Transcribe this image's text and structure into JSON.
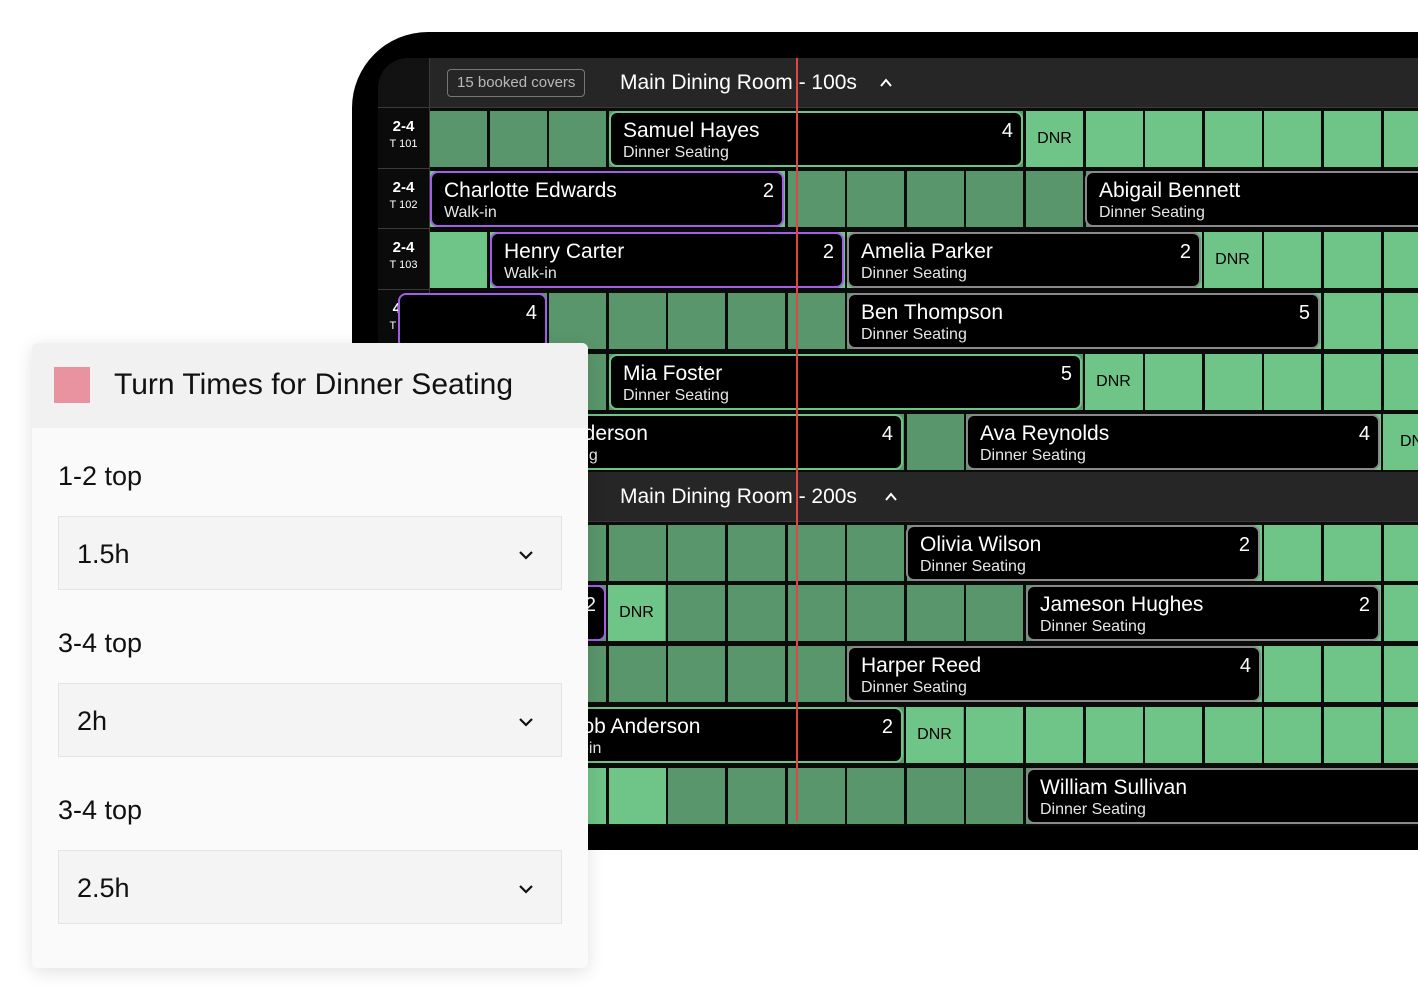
{
  "floor": {
    "booked_covers": "15 booked covers",
    "time_indicator_color": "#e04545",
    "colors": {
      "slot_free": "#6fc487",
      "slot_blocked": "#5a966b",
      "seated_outline": "#6fc487",
      "walkin_outline": "#a45ee6",
      "booked_outline": "#8a8a8a"
    },
    "sections": [
      {
        "title": "Main Dining Room - 100s",
        "rows": [
          {
            "size": "2-4",
            "table": "T 101"
          },
          {
            "size": "2-4",
            "table": "T 102"
          },
          {
            "size": "2-4",
            "table": "T 103"
          },
          {
            "size": "4-6",
            "table": "T 104"
          },
          {
            "size": "",
            "table": ""
          },
          {
            "size": "",
            "table": ""
          }
        ]
      },
      {
        "title": "Main Dining Room - 200s",
        "rows": [
          {
            "size": "",
            "table": ""
          },
          {
            "size": "",
            "table": ""
          },
          {
            "size": "",
            "table": ""
          },
          {
            "size": "",
            "table": ""
          },
          {
            "size": "",
            "table": ""
          }
        ]
      }
    ],
    "reservations": {
      "r1": {
        "name": "Samuel Hayes",
        "type": "Dinner Seating",
        "party": "4"
      },
      "r2": {
        "name": "Charlotte Edwards",
        "type": "Walk-in",
        "party": "2"
      },
      "r3": {
        "name": "Abigail Bennett",
        "type": "Dinner Seating",
        "party": ""
      },
      "r4": {
        "name": "Henry Carter",
        "type": "Walk-in",
        "party": "2"
      },
      "r5": {
        "name": "Amelia Parker",
        "type": "Dinner Seating",
        "party": "2"
      },
      "r6": {
        "name": "",
        "type": "",
        "party": "4"
      },
      "r7": {
        "name": "Ben Thompson",
        "type": "Dinner Seating",
        "party": "5"
      },
      "r8": {
        "name": "Mia Foster",
        "type": "Dinner Seating",
        "party": "5"
      },
      "r9": {
        "name": "nderson",
        "type": "ting",
        "party": "4"
      },
      "r10": {
        "name": "Ava Reynolds",
        "type": "Dinner Seating",
        "party": "4"
      },
      "r11": {
        "name": "Olivia Wilson",
        "type": "Dinner Seating",
        "party": "2"
      },
      "r12": {
        "name": "",
        "type": "",
        "party": "2"
      },
      "r13": {
        "name": "Jameson Hughes",
        "type": "Dinner Seating",
        "party": "2"
      },
      "r14": {
        "name": "Harper Reed",
        "type": "Dinner Seating",
        "party": "4"
      },
      "r15": {
        "name": "cob Anderson",
        "type": "lk-in",
        "party": "2"
      },
      "r16": {
        "name": "William Sullivan",
        "type": "Dinner Seating",
        "party": ""
      }
    },
    "dnr_label": "DNR",
    "dnr_partial": "DN"
  },
  "panel": {
    "title": "Turn Times for Dinner Seating",
    "swatch_color": "#e8939f",
    "fields": [
      {
        "label": "1-2 top",
        "value": "1.5h"
      },
      {
        "label": "3-4 top",
        "value": "2h"
      },
      {
        "label": "3-4 top",
        "value": "2.5h"
      }
    ]
  }
}
